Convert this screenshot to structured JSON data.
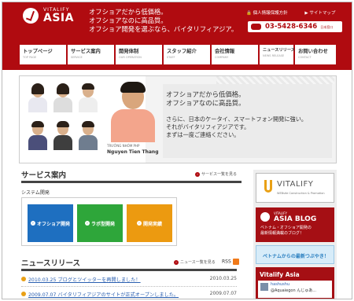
{
  "header": {
    "logo_top": "VITALIFY",
    "logo_main": "ASIA",
    "tagline": [
      "オフショアだから低価格。",
      "オフショアなのに高品質。",
      "オフショア開発を選ぶなら、バイタリフィアジア。"
    ],
    "privacy_link": "個人情報保護方針",
    "sitemap_link": "サイトマップ",
    "phone": "03-5428-6346",
    "phone_note": "日本窓口"
  },
  "nav": [
    {
      "jp": "トップページ",
      "en": "TOP PAGE"
    },
    {
      "jp": "サービス案内",
      "en": "SERVICE"
    },
    {
      "jp": "開発体制",
      "en": "OUR OPERATION"
    },
    {
      "jp": "スタッフ紹介",
      "en": "STAFF"
    },
    {
      "jp": "会社情報",
      "en": "COMPANY"
    },
    {
      "jp": "ニュースリリース",
      "en": "NEWS RELEASE"
    },
    {
      "jp": "お問い合わせ",
      "en": "CONTACT"
    }
  ],
  "hero": {
    "lead1": "オフショアだから低価格。",
    "lead2": "オフショアなのに高品質。",
    "body1": "さらに、日本のケータイ、スマートフォン開発に強い。",
    "body2": "それがバイタリフィアジアです。",
    "body3": "まずは一度ご連絡ください。",
    "caption_sub": "TRƯỞNG NHÓM PHP",
    "caption_name": "Nguyen Tien Thang"
  },
  "services": {
    "title": "サービス案内",
    "link": "サービス一覧を見る",
    "sub": "システム開発",
    "items": [
      {
        "label": "オフショア開発",
        "color": "#1e6fc0"
      },
      {
        "label": "ラボ型開発",
        "color": "#2ea63a"
      },
      {
        "label": "開発実績",
        "color": "#ec9a10"
      }
    ]
  },
  "news": {
    "title": "ニュースリリース",
    "link": "ニュース一覧を見る",
    "rss": "RSS",
    "items": [
      {
        "title": "2010.03.25 ブログとツイッターを再開しました！",
        "date": "2010.03.25"
      },
      {
        "title": "2009.07.07 バイタリフィアジアのサイトが正式オープンしました。",
        "date": "2009.07.07"
      }
    ]
  },
  "sidebar": {
    "vitalify": "VITALIFY",
    "vitalify_sub": "WEBsite Construction & Promotion",
    "blog_top": "VITALIFY",
    "blog_title": "ASIA BLOG",
    "blog_desc1": "ベトナム・オフショア開発の",
    "blog_desc2": "最新情報満載のブログ！",
    "twitter_banner": "ベトナムからの最新つぶやき！",
    "twitter_title": "Vitalify Asia",
    "tweet_user": "hashushu",
    "tweet_text": "@Aquaiegon んじゅあ..."
  }
}
